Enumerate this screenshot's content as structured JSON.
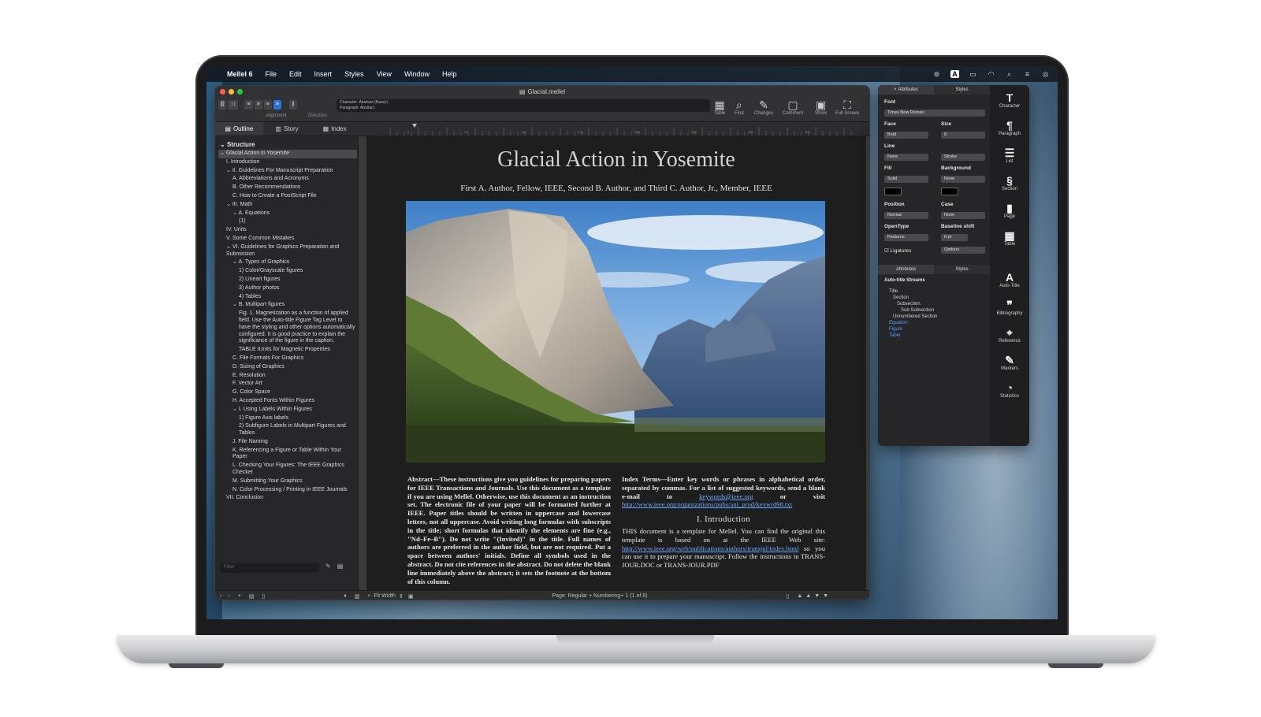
{
  "menubar": {
    "app": "Mellel 6",
    "items": [
      "File",
      "Edit",
      "Insert",
      "Styles",
      "View",
      "Window",
      "Help"
    ]
  },
  "window": {
    "title": "Glacial.mellel"
  },
  "toolbar": {
    "char_style": "Character: Abstract (Base)+",
    "para_style": "Paragraph: Abstract",
    "alignment_label": "Alignment",
    "direction_label": "Direction",
    "buttons": [
      {
        "label": "Table",
        "icon": "table-icon"
      },
      {
        "label": "Find",
        "icon": "search-icon"
      },
      {
        "label": "Changes",
        "icon": "changes-icon"
      },
      {
        "label": "Comment",
        "icon": "comment-icon"
      },
      {
        "label": "Show",
        "icon": "show-icon"
      },
      {
        "label": "Full Screen",
        "icon": "fullscreen-icon"
      }
    ]
  },
  "sidebar": {
    "tabs": [
      "Outline",
      "Story",
      "Index"
    ],
    "heading": "Structure",
    "items": [
      {
        "label": "Glacial Action in Yosemite",
        "indent": 0,
        "selected": true,
        "expander": "v"
      },
      {
        "label": "I. Introduction",
        "indent": 1
      },
      {
        "label": "II. Guidelines For Manuscript Preparation",
        "indent": 1,
        "expander": "v"
      },
      {
        "label": "A. Abbreviations and Acronyms",
        "indent": 2
      },
      {
        "label": "B. Other Recommendations",
        "indent": 2
      },
      {
        "label": "C. How to Create a PostScript File",
        "indent": 2
      },
      {
        "label": "III. Math",
        "indent": 1,
        "expander": "v"
      },
      {
        "label": "A. Equations",
        "indent": 2,
        "expander": "v"
      },
      {
        "label": "(1)",
        "indent": 3
      },
      {
        "label": "IV. Units",
        "indent": 1
      },
      {
        "label": "V. Some Common Mistakes",
        "indent": 1
      },
      {
        "label": "VI. Guidelines for Graphics Preparation and Submission",
        "indent": 1,
        "expander": "v"
      },
      {
        "label": "A. Types of Graphics",
        "indent": 2,
        "expander": "v"
      },
      {
        "label": "1) Color/Grayscale figures",
        "indent": 3
      },
      {
        "label": "2) Lineart figures",
        "indent": 3
      },
      {
        "label": "3) Author photos",
        "indent": 3
      },
      {
        "label": "4) Tables",
        "indent": 3
      },
      {
        "label": "B. Multipart figures",
        "indent": 2,
        "expander": "v"
      },
      {
        "label": "Fig. 1.  Magnetization as a function of applied field. Use the Auto-title Figure Tag Level to have the styling and other options automatically configured. It is good practice to explain the significance of the figure in the caption.",
        "indent": 3
      },
      {
        "label": "TABLE IUnits for Magnetic Properties",
        "indent": 3
      },
      {
        "label": "C. File Formats For Graphics",
        "indent": 2
      },
      {
        "label": "D. Sizing of Graphics",
        "indent": 2
      },
      {
        "label": "E. Resolution",
        "indent": 2
      },
      {
        "label": "F. Vector Art",
        "indent": 2
      },
      {
        "label": "G. Color Space",
        "indent": 2
      },
      {
        "label": "H. Accepted Fonts Within Figures",
        "indent": 2
      },
      {
        "label": "I. Using Labels Within Figures",
        "indent": 2,
        "expander": "v"
      },
      {
        "label": "1) Figure Axis labels",
        "indent": 3
      },
      {
        "label": "2) Subfigure Labels in Multipart Figures and Tables",
        "indent": 3
      },
      {
        "label": "J. File Naming",
        "indent": 2
      },
      {
        "label": "K. Referencing a Figure or Table Within Your Paper",
        "indent": 2
      },
      {
        "label": "L. Checking Your Figures: The IEEE Graphics Checker",
        "indent": 2
      },
      {
        "label": "M. Submitting Your Graphics",
        "indent": 2
      },
      {
        "label": "N. Color Processing / Printing in IEEE Journals",
        "indent": 2
      },
      {
        "label": "VII. Conclusion",
        "indent": 1
      }
    ],
    "filter_placeholder": "Filter"
  },
  "ruler": {
    "ticks": [
      "0",
      "72",
      "144",
      "216",
      "288",
      "360",
      "432",
      "504"
    ]
  },
  "document": {
    "title": "Glacial Action in Yosemite",
    "authors": "First A. Author, Fellow, IEEE, Second B. Author, and Third C. Author, Jr., Member, IEEE",
    "abstract": "Abstract—These instructions give you guidelines for preparing papers for IEEE Transactions and Journals. Use this document as a template if you are using Mellel. Otherwise, use this document as an instruction set. The electronic file of your paper will be formatted further at IEEE. Paper titles should be written in uppercase and lowercase letters, not all uppercase. Avoid writing long formulas with subscripts in the title; short formulas that identify the elements are fine (e.g., \"Nd–Fe–B\"). Do not write \"(Invited)\" in the title. Full names of authors are preferred in the author field, but are not required. Put a space between authors' initials. Define all symbols used in the abstract. Do not cite references in the abstract. Do not delete the blank line immediately above the abstract; it sets the footnote at the bottom of this column.",
    "index_terms_1": "Index Terms—Enter key words or phrases in alphabetical order, separated by commas. For a list of suggested keywords, send a blank e-mail to ",
    "index_link_1": "keywords@ieee.org",
    "index_terms_2": " or visit ",
    "index_link_2": "http://www.ieee.org/organizations/pubs/ani_prod/keywrd98.txt",
    "section_title": "I. Introduction",
    "intro_1": "THIS document is a template for Mellel. You can find the original this template is based on at the IEEE Web site: ",
    "intro_link": "http://www.ieee.org/web/publications/authors/transjnl/index.html",
    "intro_2": " so you can use it to prepare your manuscript. Follow the instructions in TRANS-JOUR.DOC or TRANS-JOUR.PDF"
  },
  "statusbar": {
    "zoom": "Fit Width",
    "page_info": "Page: Regular + Numbering+ 1 (1 of 8)"
  },
  "inspector": {
    "tabs": [
      "Attributes",
      "Styles"
    ],
    "font_label": "Font",
    "font_value": "Times New Roman",
    "face_label": "Face",
    "face_value": "Bold",
    "size_label": "Size",
    "size_value": "9",
    "line_label": "Line",
    "line_value": "None",
    "stroke_value": "Stroke",
    "fill_label": "Fill",
    "fill_value": "Solid",
    "background_label": "Background",
    "background_value": "None",
    "position_label": "Position",
    "position_value": "Normal",
    "case_label": "Case",
    "case_value": "None",
    "opentype_label": "OpenType",
    "opentype_value": "Features",
    "baseline_label": "Baseline shift",
    "baseline_value": "0 pt",
    "ligatures_label": "Ligatures",
    "options_value": "Options",
    "streams_label": "Auto-title Streams",
    "streams": [
      {
        "label": "Title",
        "indent": 0
      },
      {
        "label": "Section",
        "indent": 1
      },
      {
        "label": "Subsection",
        "indent": 2
      },
      {
        "label": "Sub Subsection",
        "indent": 3
      },
      {
        "label": "Unnumbered Section",
        "indent": 1
      },
      {
        "label": "Equation",
        "indent": 0,
        "blue": true
      },
      {
        "label": "Figure",
        "indent": 0,
        "blue": true
      },
      {
        "label": "Table",
        "indent": 0,
        "blue": true
      }
    ],
    "side_top": [
      {
        "label": "Character",
        "glyph": "T"
      },
      {
        "label": "Paragraph",
        "glyph": "¶"
      },
      {
        "label": "List",
        "glyph": "☰"
      },
      {
        "label": "Section",
        "glyph": "§"
      },
      {
        "label": "Page",
        "glyph": "▮"
      },
      {
        "label": "Table",
        "glyph": "▦"
      }
    ],
    "side_bottom": [
      {
        "label": "Auto-Title",
        "glyph": "A"
      },
      {
        "label": "Bibliography",
        "glyph": "❞"
      },
      {
        "label": "Reference",
        "glyph": "⌖"
      },
      {
        "label": "Markers",
        "glyph": "✎"
      },
      {
        "label": "Statistics",
        "glyph": "◔"
      }
    ]
  }
}
